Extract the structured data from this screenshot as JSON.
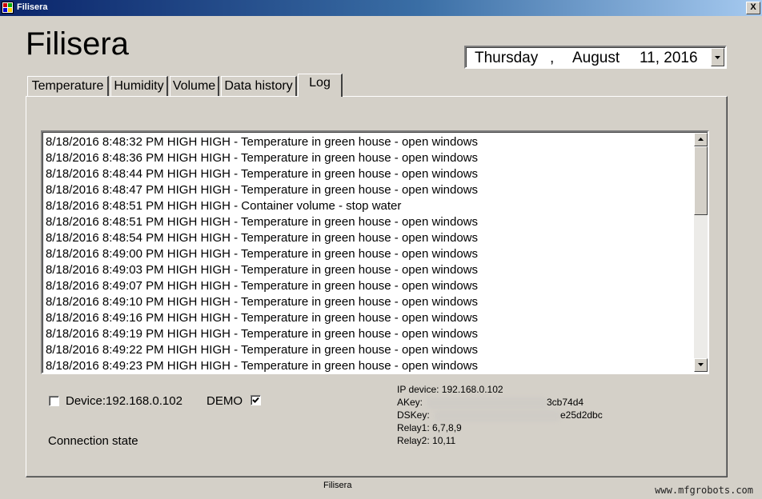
{
  "window": {
    "title": "Filisera",
    "close_label": "X"
  },
  "app_title": "Filisera",
  "date_picker": {
    "weekday": "Thursday",
    "separator": ",",
    "month": "August",
    "day_year": "11, 2016"
  },
  "tabs": [
    {
      "label": "Temperature"
    },
    {
      "label": "Humidity"
    },
    {
      "label": "Volume"
    },
    {
      "label": "Data history"
    },
    {
      "label": "Log"
    }
  ],
  "active_tab": "Log",
  "log": {
    "entries": [
      "8/18/2016 8:48:32 PM HIGH HIGH - Temperature in green house - open windows",
      "8/18/2016 8:48:36 PM HIGH HIGH - Temperature in green house - open windows",
      "8/18/2016 8:48:44 PM HIGH HIGH - Temperature in green house - open windows",
      "8/18/2016 8:48:47 PM HIGH HIGH - Temperature in green house - open windows",
      "8/18/2016 8:48:51 PM HIGH HIGH - Container volume - stop water",
      "8/18/2016 8:48:51 PM HIGH HIGH - Temperature in green house - open windows",
      "8/18/2016 8:48:54 PM HIGH HIGH - Temperature in green house - open windows",
      "8/18/2016 8:49:00 PM HIGH HIGH - Temperature in green house - open windows",
      "8/18/2016 8:49:03 PM HIGH HIGH - Temperature in green house - open windows",
      "8/18/2016 8:49:07 PM HIGH HIGH - Temperature in green house - open windows",
      "8/18/2016 8:49:10 PM HIGH HIGH - Temperature in green house - open windows",
      "8/18/2016 8:49:16 PM HIGH HIGH - Temperature in green house - open windows",
      "8/18/2016 8:49:19 PM HIGH HIGH - Temperature in green house - open windows",
      "8/18/2016 8:49:22 PM HIGH HIGH - Temperature in green house - open windows",
      "8/18/2016 8:49:23 PM HIGH HIGH - Temperature in green house - open windows"
    ]
  },
  "device": {
    "label": "Device:192.168.0.102",
    "checked": false
  },
  "demo": {
    "label": "DEMO",
    "checked": true
  },
  "connection_state": "Connection state",
  "info": {
    "ip": "IP device: 192.168.0.102",
    "akey_label": "AKey:",
    "akey_visible_suffix": "3cb74d4",
    "dskey_label": "DSKey:",
    "dskey_visible_suffix": "e25d2dbc",
    "relay1": "Relay1: 6,7,8,9",
    "relay2": "Relay2: 10,11"
  },
  "status_bar": "Filisera",
  "watermark": "www.mfgrobots.com",
  "colors": {
    "title_bar_start": "#0a246a",
    "title_bar_end": "#a6caf0",
    "face": "#d4d0c8"
  },
  "icons": [
    "app-icon",
    "close-icon",
    "dropdown-arrow-icon",
    "scroll-up-icon",
    "scroll-down-icon",
    "checkmark-icon"
  ]
}
